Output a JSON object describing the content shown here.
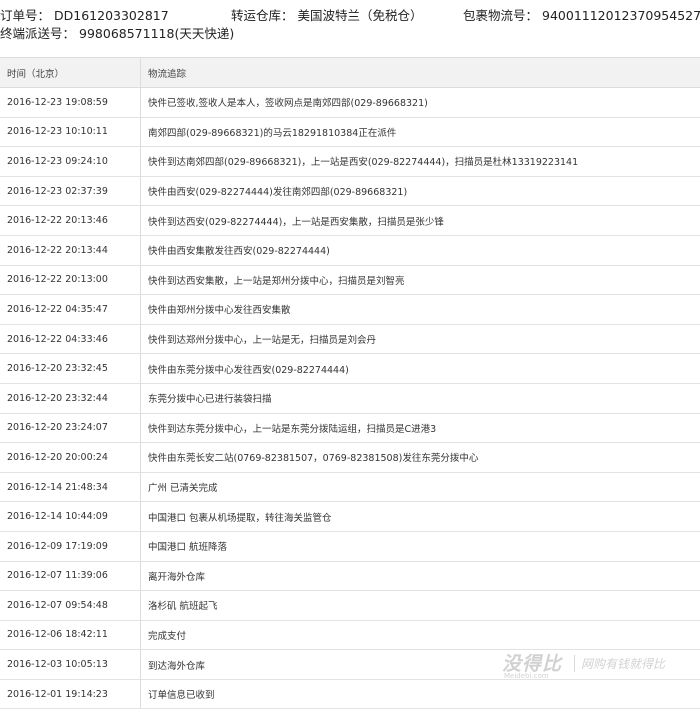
{
  "header": {
    "order_label": "订单号：",
    "order_value": "DD161203302817",
    "warehouse_label": "转运仓库：",
    "warehouse_value": "美国波特兰（免税仓）",
    "tracking_label": "包裹物流号：",
    "tracking_value": "9400111201237095452714",
    "final_label": "终端派送号：",
    "final_value": "998068571118(天天快递)"
  },
  "table": {
    "columns": [
      "时间（北京）",
      "物流追踪"
    ],
    "rows": [
      {
        "time": "2016-12-23 19:08:59",
        "info": "快件已签收,签收人是本人，签收网点是南郊四部(029-89668321)"
      },
      {
        "time": "2016-12-23 10:10:11",
        "info": "南郊四部(029-89668321)的马云18291810384正在派件"
      },
      {
        "time": "2016-12-23 09:24:10",
        "info": "快件到达南郊四部(029-89668321)，上一站是西安(029-82274444)，扫描员是杜林13319223141"
      },
      {
        "time": "2016-12-23 02:37:39",
        "info": "快件由西安(029-82274444)发往南郊四部(029-89668321)"
      },
      {
        "time": "2016-12-22 20:13:46",
        "info": "快件到达西安(029-82274444)，上一站是西安集散，扫描员是张少锋"
      },
      {
        "time": "2016-12-22 20:13:44",
        "info": "快件由西安集散发往西安(029-82274444)"
      },
      {
        "time": "2016-12-22 20:13:00",
        "info": "快件到达西安集散，上一站是郑州分拨中心，扫描员是刘智亮"
      },
      {
        "time": "2016-12-22 04:35:47",
        "info": "快件由郑州分拨中心发往西安集散"
      },
      {
        "time": "2016-12-22 04:33:46",
        "info": "快件到达郑州分拨中心，上一站是无，扫描员是刘会丹"
      },
      {
        "time": "2016-12-20 23:32:45",
        "info": "快件由东莞分拨中心发往西安(029-82274444)"
      },
      {
        "time": "2016-12-20 23:32:44",
        "info": "东莞分拨中心已进行装袋扫描"
      },
      {
        "time": "2016-12-20 23:24:07",
        "info": "快件到达东莞分拨中心，上一站是东莞分拨陆运组，扫描员是C进港3"
      },
      {
        "time": "2016-12-20 20:00:24",
        "info": "快件由东莞长安二站(0769-82381507，0769-82381508)发往东莞分拨中心"
      },
      {
        "time": "2016-12-14 21:48:34",
        "info": "广州 已清关完成"
      },
      {
        "time": "2016-12-14 10:44:09",
        "info": "中国港口 包裹从机场提取，转往海关监管仓"
      },
      {
        "time": "2016-12-09 17:19:09",
        "info": "中国港口 航班降落"
      },
      {
        "time": "2016-12-07 11:39:06",
        "info": "离开海外仓库"
      },
      {
        "time": "2016-12-07 09:54:48",
        "info": "洛杉矶 航班起飞"
      },
      {
        "time": "2016-12-06 18:42:11",
        "info": "完成支付"
      },
      {
        "time": "2016-12-03 10:05:13",
        "info": "到达海外仓库"
      },
      {
        "time": "2016-12-01 19:14:23",
        "info": "订单信息已收到"
      }
    ]
  },
  "watermark": {
    "logo": "没得比",
    "sub": "Meidebi.com",
    "slogan": "网购有钱就得比"
  }
}
